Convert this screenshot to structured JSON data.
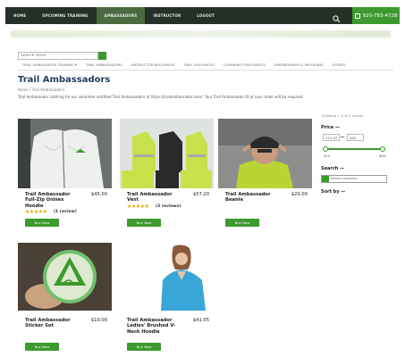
{
  "nav": {
    "items": [
      "HOME",
      "UPCOMING TRAINING",
      "AMBASSADORS",
      "INSTRUCTOR",
      "LOGOUT"
    ],
    "active_index": 2,
    "phone": "920-783-4728"
  },
  "search": {
    "placeholder": "Search store"
  },
  "categories": [
    "TRAIL AMBASSADOR TRAINING ▾",
    "TRAIL AMBASSADORS",
    "INSTRUCTOR RESOURCES",
    "TRAIL RESOURCES",
    "COMMUNITY RESOURCES",
    "PARTNERSHIPS & PROGRAMS",
    "EVENTS"
  ],
  "page": {
    "title": "Trail Ambassadors",
    "breadcrumb": "Home / Trail Ambassadors",
    "intro": "Trail Ambassador clothing for our volunteer certified Trail Ambassadors at https://trailambassador.com/. Your Trail Ambassador ID at your order will be required.",
    "result_count": "Showing 1–5 of 5 results"
  },
  "products": [
    {
      "name": "Trail Ambassador Full-Zip Unisex Hoodie",
      "price": "$45.00",
      "rating": 5,
      "reviews": "(1 review)",
      "button": "Buy Now"
    },
    {
      "name": "Trail Ambassador Vest",
      "price": "$57.20",
      "rating": 5,
      "reviews": "(3 reviews)",
      "button": "Buy Now"
    },
    {
      "name": "Trail Ambassador Beanie",
      "price": "$20.00",
      "rating": 0,
      "reviews": "",
      "button": "Buy Now"
    },
    {
      "name": "Trail Ambassador Sticker Set",
      "price": "$10.00",
      "rating": 0,
      "reviews": "",
      "button": "Buy Now"
    },
    {
      "name": "Trail Ambassador Ladies' Brushed V-Neck Hoodie",
      "price": "$41.05",
      "rating": 0,
      "reviews": "",
      "button": "Buy Now"
    }
  ],
  "sidebar": {
    "price_title": "Price —",
    "price_min": "$10.00",
    "price_max": "$60",
    "range_min_label": "$10",
    "range_max_label": "$60",
    "search_title": "Search —",
    "search_placeholder": "Search products...",
    "sort_title": "Sort by —"
  },
  "colors": {
    "nav_bg": "#243028",
    "accent_green": "#3c9a2e",
    "title_blue": "#1f3d5c",
    "star": "#e0a800"
  }
}
